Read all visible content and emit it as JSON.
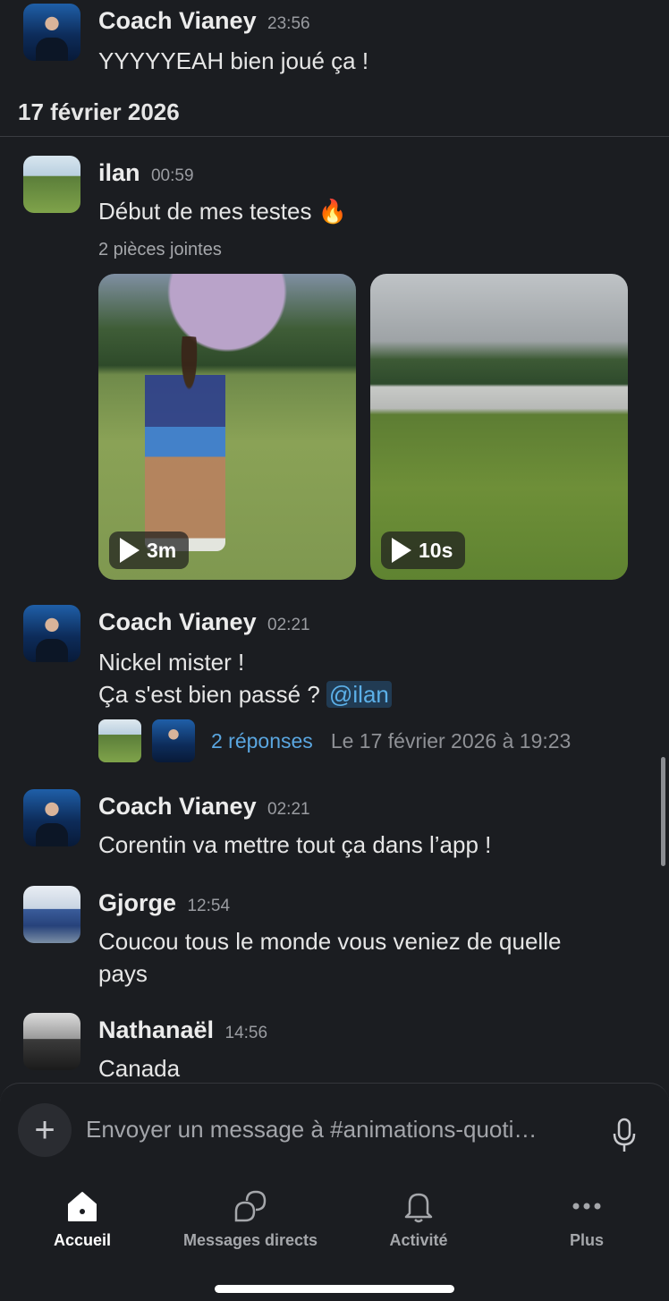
{
  "messages": [
    {
      "author": "Coach Vianey",
      "time": "23:56",
      "lines": [
        "YYYYYEAH bien joué ça !"
      ]
    },
    {
      "author": "ilan",
      "time": "00:59",
      "lines": [
        "Début de mes testes 🔥"
      ],
      "attachments_label": "2 pièces jointes",
      "videos": [
        {
          "duration": "3m"
        },
        {
          "duration": "10s"
        }
      ]
    },
    {
      "author": "Coach Vianey",
      "time": "02:21",
      "lines": [
        "Nickel mister !",
        "Ça s'est bien passé ? "
      ],
      "mention": "@ilan",
      "thread": {
        "replies": "2 réponses",
        "date": "Le 17 février 2026 à 19:23"
      }
    },
    {
      "author": "Coach Vianey",
      "time": "02:21",
      "lines": [
        "Corentin va mettre tout ça dans l’app !"
      ]
    },
    {
      "author": "Gjorge",
      "time": "12:54",
      "lines": [
        "Coucou tous le monde vous veniez de quelle",
        "pays"
      ]
    },
    {
      "author": "Nathanaël",
      "time": "14:56",
      "lines": [
        "Canada"
      ]
    }
  ],
  "date_divider": "17 février 2026",
  "composer": {
    "placeholder": "Envoyer un message à #animations-quoti…"
  },
  "tabs": [
    {
      "label": "Accueil",
      "icon": "home-icon",
      "active": true
    },
    {
      "label": "Messages directs",
      "icon": "direct-messages-icon"
    },
    {
      "label": "Activité",
      "icon": "bell-icon"
    },
    {
      "label": "Plus",
      "icon": "more-icon"
    }
  ],
  "colors": {
    "background": "#1b1d21",
    "link": "#5aa6e0",
    "mention_bg": "#213b53"
  }
}
